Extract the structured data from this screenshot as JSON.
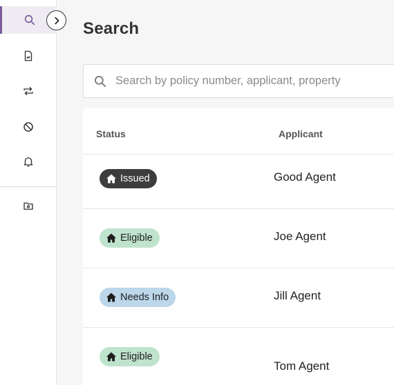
{
  "page": {
    "title": "Search"
  },
  "sidebar": {
    "items": [
      {
        "icon": "search-icon",
        "active": true
      },
      {
        "icon": "document-icon",
        "active": false
      },
      {
        "icon": "transfer-icon",
        "active": false
      },
      {
        "icon": "ban-icon",
        "active": false
      },
      {
        "icon": "bell-icon",
        "active": false
      },
      {
        "icon": "folder-settings-icon",
        "active": false
      }
    ],
    "toggle_icon": "chevron-right-icon"
  },
  "search": {
    "placeholder": "Search by policy number, applicant, property",
    "value": ""
  },
  "table": {
    "columns": [
      "Status",
      "Applicant"
    ],
    "rows": [
      {
        "status": "Issued",
        "applicant": "Good Agent"
      },
      {
        "status": "Eligible",
        "applicant": "Joe Agent"
      },
      {
        "status": "Needs Info",
        "applicant": "Jill Agent"
      },
      {
        "status": "Eligible",
        "applicant": "Tom Agent"
      }
    ]
  },
  "colors": {
    "accent": "#7a5c9c",
    "issued": "#3d3d3d",
    "eligible": "#bfe3cc",
    "needs_info": "#bcd6ea"
  }
}
